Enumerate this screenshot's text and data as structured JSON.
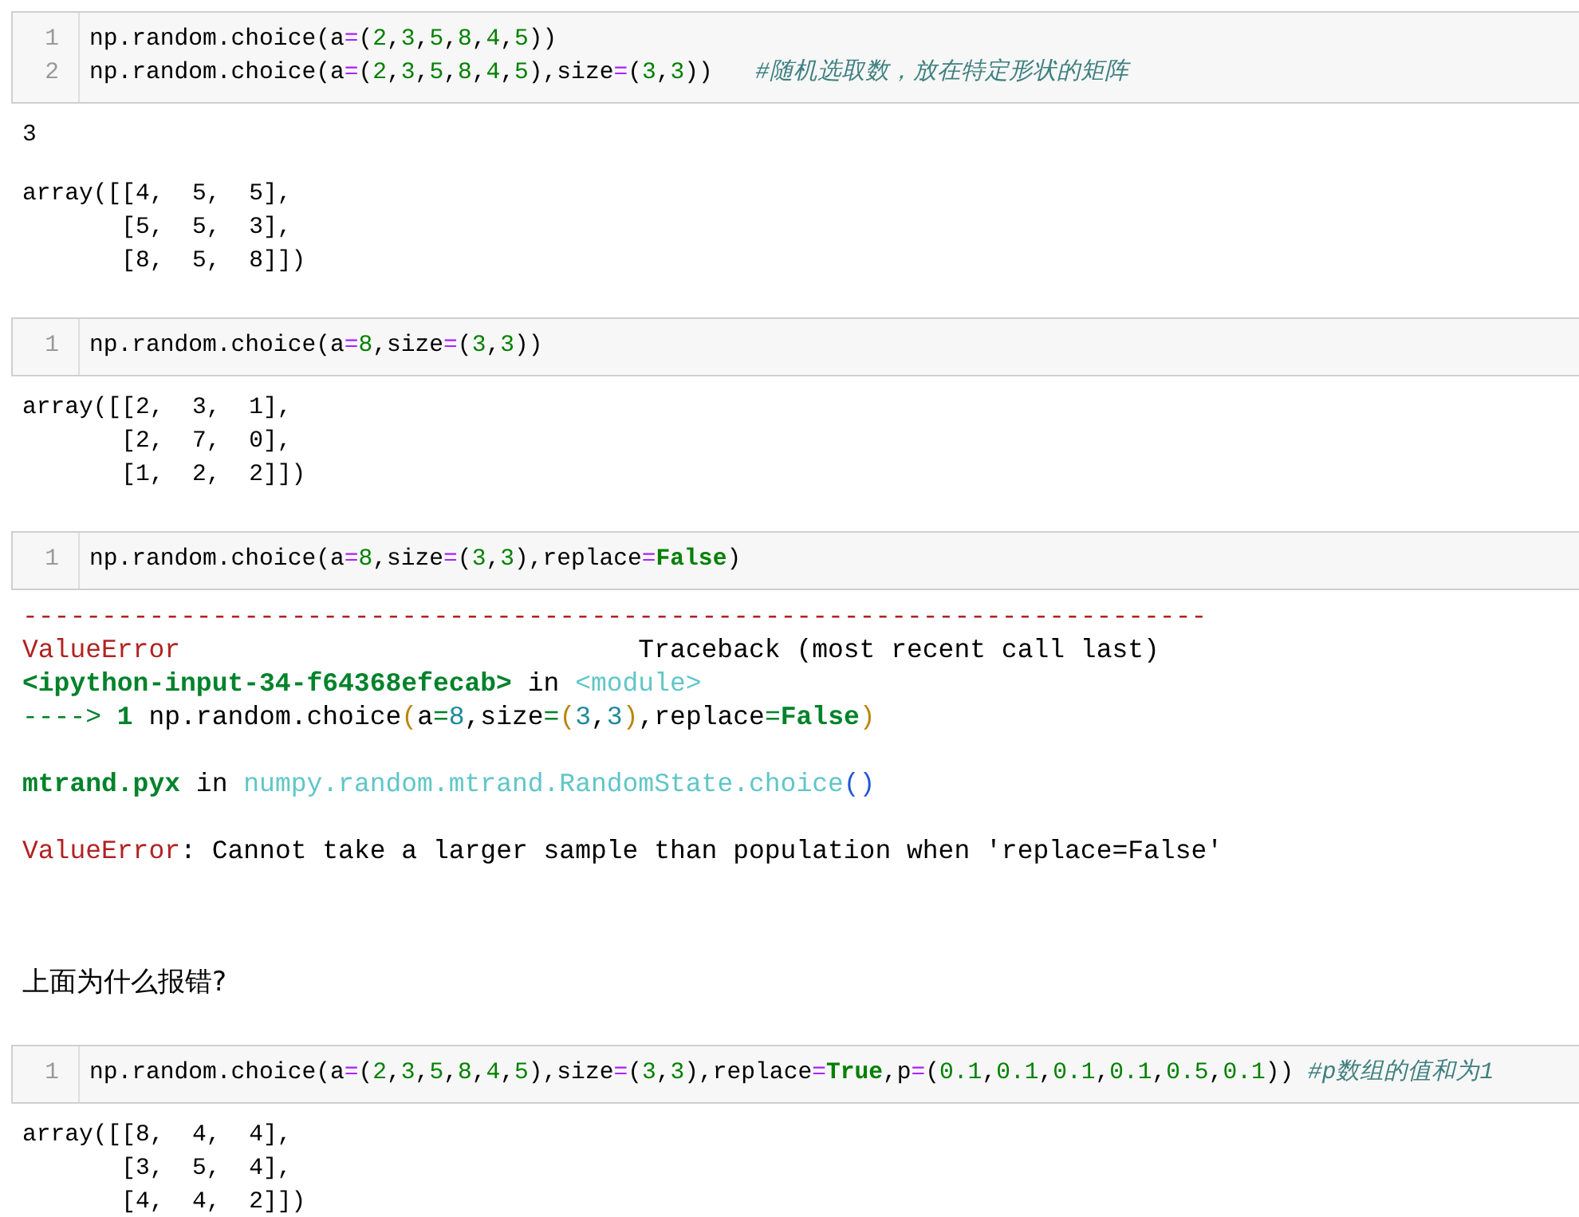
{
  "cells": [
    {
      "kind": "code",
      "lines": [
        {
          "number": "1",
          "tokens": [
            {
              "kind": "plain",
              "text": "np.random.choice(a"
            },
            {
              "kind": "op",
              "text": "="
            },
            {
              "kind": "plain",
              "text": "("
            },
            {
              "kind": "num",
              "text": "2"
            },
            {
              "kind": "plain",
              "text": ","
            },
            {
              "kind": "num",
              "text": "3"
            },
            {
              "kind": "plain",
              "text": ","
            },
            {
              "kind": "num",
              "text": "5"
            },
            {
              "kind": "plain",
              "text": ","
            },
            {
              "kind": "num",
              "text": "8"
            },
            {
              "kind": "plain",
              "text": ","
            },
            {
              "kind": "num",
              "text": "4"
            },
            {
              "kind": "plain",
              "text": ","
            },
            {
              "kind": "num",
              "text": "5"
            },
            {
              "kind": "plain",
              "text": "))"
            }
          ]
        },
        {
          "number": "2",
          "tokens": [
            {
              "kind": "plain",
              "text": "np.random.choice(a"
            },
            {
              "kind": "op",
              "text": "="
            },
            {
              "kind": "plain",
              "text": "("
            },
            {
              "kind": "num",
              "text": "2"
            },
            {
              "kind": "plain",
              "text": ","
            },
            {
              "kind": "num",
              "text": "3"
            },
            {
              "kind": "plain",
              "text": ","
            },
            {
              "kind": "num",
              "text": "5"
            },
            {
              "kind": "plain",
              "text": ","
            },
            {
              "kind": "num",
              "text": "8"
            },
            {
              "kind": "plain",
              "text": ","
            },
            {
              "kind": "num",
              "text": "4"
            },
            {
              "kind": "plain",
              "text": ","
            },
            {
              "kind": "num",
              "text": "5"
            },
            {
              "kind": "plain",
              "text": "),size"
            },
            {
              "kind": "op",
              "text": "="
            },
            {
              "kind": "plain",
              "text": "("
            },
            {
              "kind": "num",
              "text": "3"
            },
            {
              "kind": "plain",
              "text": ","
            },
            {
              "kind": "num",
              "text": "3"
            },
            {
              "kind": "plain",
              "text": "))   "
            },
            {
              "kind": "comment",
              "text": "#随机选取数，放在特定形状的矩阵"
            }
          ]
        }
      ]
    },
    {
      "kind": "output",
      "blocks": [
        [
          "3"
        ],
        [
          "array([[4,  5,  5],",
          "       [5,  5,  3],",
          "       [8,  5,  8]])"
        ]
      ]
    },
    {
      "kind": "code",
      "lines": [
        {
          "number": "1",
          "tokens": [
            {
              "kind": "plain",
              "text": "np.random.choice(a"
            },
            {
              "kind": "op",
              "text": "="
            },
            {
              "kind": "num",
              "text": "8"
            },
            {
              "kind": "plain",
              "text": ",size"
            },
            {
              "kind": "op",
              "text": "="
            },
            {
              "kind": "plain",
              "text": "("
            },
            {
              "kind": "num",
              "text": "3"
            },
            {
              "kind": "plain",
              "text": ","
            },
            {
              "kind": "num",
              "text": "3"
            },
            {
              "kind": "plain",
              "text": "))"
            }
          ]
        }
      ]
    },
    {
      "kind": "output",
      "blocks": [
        [
          "array([[2,  3,  1],",
          "       [2,  7,  0],",
          "       [1,  2,  2]])"
        ]
      ]
    },
    {
      "kind": "code",
      "lines": [
        {
          "number": "1",
          "tokens": [
            {
              "kind": "plain",
              "text": "np.random.choice(a"
            },
            {
              "kind": "op",
              "text": "="
            },
            {
              "kind": "num",
              "text": "8"
            },
            {
              "kind": "plain",
              "text": ",size"
            },
            {
              "kind": "op",
              "text": "="
            },
            {
              "kind": "plain",
              "text": "("
            },
            {
              "kind": "num",
              "text": "3"
            },
            {
              "kind": "plain",
              "text": ","
            },
            {
              "kind": "num",
              "text": "3"
            },
            {
              "kind": "plain",
              "text": "),replace"
            },
            {
              "kind": "op",
              "text": "="
            },
            {
              "kind": "keyword",
              "text": "False"
            },
            {
              "kind": "plain",
              "text": ")"
            }
          ]
        }
      ]
    },
    {
      "kind": "traceback",
      "blocks": [
        [
          [
            {
              "kind": "error",
              "text": "---------------------------------------------------------------------------"
            }
          ],
          [
            {
              "kind": "error",
              "text": "ValueError"
            },
            {
              "kind": "plain",
              "text": "                             Traceback (most recent call last)"
            }
          ],
          [
            {
              "kind": "location",
              "text": "<ipython-input-34-f64368efecab>"
            },
            {
              "kind": "plain",
              "text": " in "
            },
            {
              "kind": "link",
              "text": "<module>"
            }
          ],
          [
            {
              "kind": "arrow",
              "text": "----> "
            },
            {
              "kind": "location",
              "text": "1"
            },
            {
              "kind": "plain",
              "text": " np.random.choice"
            },
            {
              "kind": "paren",
              "text": "("
            },
            {
              "kind": "plain",
              "text": "a"
            },
            {
              "kind": "arrow",
              "text": "="
            },
            {
              "kind": "number",
              "text": "8"
            },
            {
              "kind": "plain",
              "text": ",size"
            },
            {
              "kind": "arrow",
              "text": "="
            },
            {
              "kind": "paren",
              "text": "("
            },
            {
              "kind": "number",
              "text": "3"
            },
            {
              "kind": "plain",
              "text": ","
            },
            {
              "kind": "number",
              "text": "3"
            },
            {
              "kind": "paren",
              "text": ")"
            },
            {
              "kind": "plain",
              "text": ",replace"
            },
            {
              "kind": "arrow",
              "text": "="
            },
            {
              "kind": "location",
              "text": "False"
            },
            {
              "kind": "paren",
              "text": ")"
            }
          ]
        ],
        [
          [
            {
              "kind": "location",
              "text": "mtrand.pyx"
            },
            {
              "kind": "plain",
              "text": " in "
            },
            {
              "kind": "link",
              "text": "numpy.random.mtrand.RandomState.choice"
            },
            {
              "kind": "call",
              "text": "()"
            }
          ]
        ],
        [
          [
            {
              "kind": "error",
              "text": "ValueError"
            },
            {
              "kind": "plain",
              "text": ": Cannot take a larger sample than population when 'replace=False'"
            }
          ]
        ]
      ]
    },
    {
      "kind": "markdown",
      "text": "上面为什么报错?"
    },
    {
      "kind": "code",
      "lines": [
        {
          "number": "1",
          "tokens": [
            {
              "kind": "plain",
              "text": "np.random.choice(a"
            },
            {
              "kind": "op",
              "text": "="
            },
            {
              "kind": "plain",
              "text": "("
            },
            {
              "kind": "num",
              "text": "2"
            },
            {
              "kind": "plain",
              "text": ","
            },
            {
              "kind": "num",
              "text": "3"
            },
            {
              "kind": "plain",
              "text": ","
            },
            {
              "kind": "num",
              "text": "5"
            },
            {
              "kind": "plain",
              "text": ","
            },
            {
              "kind": "num",
              "text": "8"
            },
            {
              "kind": "plain",
              "text": ","
            },
            {
              "kind": "num",
              "text": "4"
            },
            {
              "kind": "plain",
              "text": ","
            },
            {
              "kind": "num",
              "text": "5"
            },
            {
              "kind": "plain",
              "text": "),size"
            },
            {
              "kind": "op",
              "text": "="
            },
            {
              "kind": "plain",
              "text": "("
            },
            {
              "kind": "num",
              "text": "3"
            },
            {
              "kind": "plain",
              "text": ","
            },
            {
              "kind": "num",
              "text": "3"
            },
            {
              "kind": "plain",
              "text": "),replace"
            },
            {
              "kind": "op",
              "text": "="
            },
            {
              "kind": "keyword",
              "text": "True"
            },
            {
              "kind": "plain",
              "text": ",p"
            },
            {
              "kind": "op",
              "text": "="
            },
            {
              "kind": "plain",
              "text": "("
            },
            {
              "kind": "num",
              "text": "0.1"
            },
            {
              "kind": "plain",
              "text": ","
            },
            {
              "kind": "num",
              "text": "0.1"
            },
            {
              "kind": "plain",
              "text": ","
            },
            {
              "kind": "num",
              "text": "0.1"
            },
            {
              "kind": "plain",
              "text": ","
            },
            {
              "kind": "num",
              "text": "0.1"
            },
            {
              "kind": "plain",
              "text": ","
            },
            {
              "kind": "num",
              "text": "0.5"
            },
            {
              "kind": "plain",
              "text": ","
            },
            {
              "kind": "num",
              "text": "0.1"
            },
            {
              "kind": "plain",
              "text": ")) "
            },
            {
              "kind": "comment",
              "text": "#p数组的值和为1"
            }
          ]
        }
      ]
    },
    {
      "kind": "output",
      "blocks": [
        [
          "array([[8,  4,  4],",
          "       [3,  5,  4],",
          "       [4,  4,  2]])"
        ]
      ]
    }
  ]
}
